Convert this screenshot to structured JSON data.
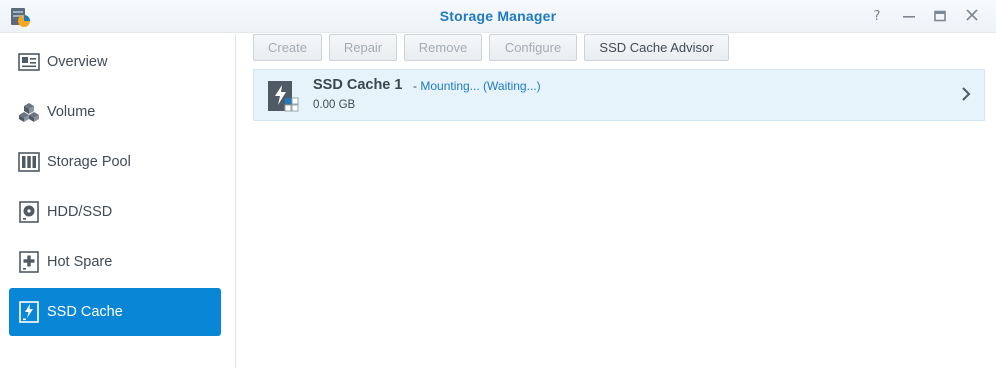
{
  "window": {
    "title": "Storage Manager",
    "controls": {
      "help": "?",
      "minimize": "—",
      "maximize": "☐",
      "close": "✕"
    }
  },
  "sidebar": {
    "items": [
      {
        "label": "Overview",
        "icon": "overview-icon",
        "active": false
      },
      {
        "label": "Volume",
        "icon": "volume-icon",
        "active": false
      },
      {
        "label": "Storage Pool",
        "icon": "storage-pool-icon",
        "active": false
      },
      {
        "label": "HDD/SSD",
        "icon": "hdd-icon",
        "active": false
      },
      {
        "label": "Hot Spare",
        "icon": "hot-spare-icon",
        "active": false
      },
      {
        "label": "SSD Cache",
        "icon": "ssd-cache-icon",
        "active": true
      }
    ]
  },
  "toolbar": {
    "create": "Create",
    "repair": "Repair",
    "remove": "Remove",
    "configure": "Configure",
    "advisor": "SSD Cache Advisor"
  },
  "caches": [
    {
      "name": "SSD Cache 1",
      "separator": " - ",
      "status": "Mounting... (Waiting...)",
      "size": "0.00 GB"
    }
  ],
  "colors": {
    "accent": "#0a86d6",
    "title": "#1f7bc1",
    "row_highlight": "#e6f3fb"
  }
}
